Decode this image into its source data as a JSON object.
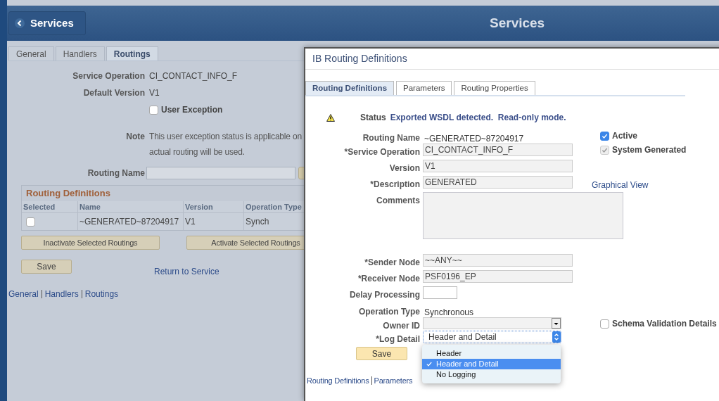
{
  "header": {
    "back_button": "Services",
    "title": "Services"
  },
  "page": {
    "tabs": [
      {
        "label": "General",
        "selected": false
      },
      {
        "label": "Handlers",
        "selected": false
      },
      {
        "label": "Routings",
        "selected": true
      }
    ],
    "fields": [
      {
        "label": "Service Operation",
        "value": "CI_CONTACT_INFO_F"
      },
      {
        "label": "Default Version",
        "value": "V1"
      }
    ],
    "user_exception": {
      "label": "User Exception",
      "checked": false
    },
    "note": {
      "label": "Note",
      "lines": [
        "This user exception status is applicable on",
        "actual routing will be used."
      ]
    },
    "routing_name": {
      "label": "Routing Name"
    },
    "grid": {
      "title": "Routing Definitions",
      "columns": [
        "Selected",
        "Name",
        "Version",
        "Operation Type"
      ],
      "rows": [
        {
          "selected": false,
          "cells": [
            "",
            "~GENERATED~87204917",
            "V1",
            "Synch"
          ]
        }
      ]
    },
    "buttons": [
      "Inactivate Selected Routings",
      "Activate Selected Routings"
    ],
    "save": "Save",
    "return_link": "Return to Service",
    "footer_links": [
      "General",
      "Handlers",
      "Routings"
    ]
  },
  "dialog": {
    "title": "IB Routing Definitions",
    "tabs": [
      {
        "label": "Routing Definitions",
        "selected": true
      },
      {
        "label": "Parameters",
        "selected": false
      },
      {
        "label": "Routing Properties",
        "selected": false
      }
    ],
    "status": {
      "label": "Status",
      "value": "Exported WSDL detected.  Read-only mode."
    },
    "fields": [
      {
        "kind": "text",
        "label": "Routing Name",
        "value": "~GENERATED~87204917",
        "aside": {
          "kind": "checkbox",
          "label": "Active",
          "checked": true,
          "disabled": false
        }
      },
      {
        "kind": "input",
        "label": "*Service Operation",
        "value": "CI_CONTACT_INFO_F",
        "aside": {
          "kind": "checkbox",
          "label": "System Generated",
          "checked": true,
          "disabled": true
        }
      },
      {
        "kind": "input",
        "label": "Version",
        "value": "V1"
      },
      {
        "kind": "input",
        "label": "*Description",
        "value": "GENERATED",
        "aside": {
          "kind": "link",
          "label": "Graphical View"
        }
      },
      {
        "kind": "textarea",
        "label": "Comments"
      },
      {
        "kind": "input",
        "label": "*Sender Node",
        "value": "~~ANY~~"
      },
      {
        "kind": "input",
        "label": "*Receiver Node",
        "value": "PSF0196_EP"
      },
      {
        "kind": "small_input",
        "label": "Delay Processing"
      },
      {
        "kind": "text",
        "label": "Operation Type",
        "value": "Synchronous"
      },
      {
        "kind": "select",
        "label": "Owner ID",
        "aside": {
          "kind": "checkbox",
          "label": "Schema Validation Details",
          "checked": false,
          "disabled": false
        }
      },
      {
        "kind": "dropdown",
        "label": "*Log Detail",
        "value": "Header and Detail",
        "expanded": true,
        "options": [
          {
            "label": "Header",
            "selected": false
          },
          {
            "label": "Header and Detail",
            "selected": true
          },
          {
            "label": "No Logging",
            "selected": false
          }
        ]
      }
    ],
    "save": "Save",
    "footer_links": [
      "Routing Definitions",
      "Parameters"
    ]
  }
}
